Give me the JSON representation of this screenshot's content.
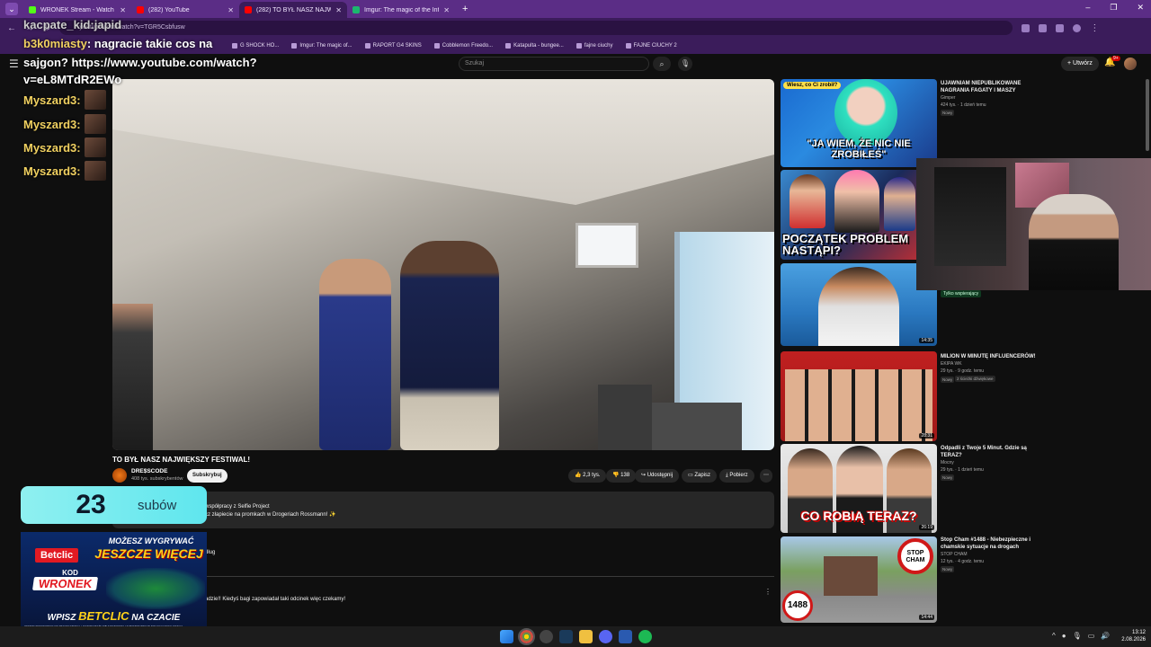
{
  "browser": {
    "tabs": [
      {
        "title": "WRONEK Stream - Watch Live",
        "color": "#53fc18"
      },
      {
        "title": "(282) YouTube",
        "color": "#ff0000"
      },
      {
        "title": "(282) TO BYŁ NASZ NAJWIĘKSZ",
        "color": "#ff0000",
        "active": true
      },
      {
        "title": "Imgur: The magic of the Interne",
        "color": "#1bb76e"
      }
    ],
    "new_tab": "+",
    "address": "youtube.com/watch?v=TGR5Csbfusw",
    "bookmarks": [
      "G SHOCK HO...",
      "Imgur: The magic of...",
      "RAPORT G4 SKINS",
      "Cobblemon Freedo...",
      "Katapulta - bungee...",
      "fajne ciuchy",
      "FAJNE CIUCHY 2"
    ]
  },
  "youtube": {
    "search_placeholder": "Szukaj",
    "create_label": "Utwórz",
    "notif_count": "9+"
  },
  "chat": {
    "line1": "kacpate_kid:japid",
    "line2_user": "b3k0miasty",
    "line2_msg": ": nagracie takie cos na",
    "line3": "sajgon? https://www.youtube.com/watch?v=eL8MTdR2EWo",
    "emote_lines": [
      "Myszard3:",
      "Myszard3:",
      "Myszard3:",
      "Myszard3:"
    ]
  },
  "video": {
    "title": "TO BYŁ NASZ NAJWIĘKSZY FESTIWAL!",
    "channel": "DRE$SCODE",
    "subscribers": "408 tys. subskrybentów",
    "subscribe_label": "Subskrybuj",
    "likes": "2,3 tys.",
    "dislikes": "138",
    "share": "Udostępnij",
    "save": "Zapisz",
    "download": "Pobierz",
    "desc1": "współpracy z Selfie Project",
    "desc2": "cz złapiecie na promkach w Drogeriach Rossmann! ✨",
    "comments_frag": "dług",
    "comment_frag": "adzie!! Kiedyś bagi zapowiadał taki odcinek więc czekamy!"
  },
  "sidebar": [
    {
      "title": "UJAWNIAM NIEPUBLIKOWANE NAGRANIA FAGATY I MASZY",
      "channel": "Gimper",
      "meta": "424 tys. · 1 dzień temu",
      "badge": "Nowy",
      "thumb_text": "\"JA WIEM, ŻE NIC NIE ZROBIŁEŚ\"",
      "bubble": "Wiesz, co Ci zrobił?"
    },
    {
      "title": "",
      "channel": "",
      "meta": "",
      "badge": "",
      "thumb_text": "POCZĄTEK PROBLEM NASTĄPI?",
      "bubble": ""
    },
    {
      "title": "",
      "channel": "",
      "meta": "",
      "badge": "",
      "duration": "14:35"
    },
    {
      "title": "MILION W MINUTĘ INFLUENCERÓW!",
      "channel": "EKIPA WK",
      "meta": "29 tys. · 9 godz. temu",
      "badge": "Nowy",
      "badge2": "2 ścieżki dźwiękowe",
      "duration": "28:31"
    },
    {
      "title": "Odpadli z Twoje 5 Minut. Gdzie są TERAZ?",
      "channel": "Mocny",
      "meta": "29 tys. · 1 dzień temu",
      "badge": "Nowy",
      "thumb_text": "CO ROBIĄ TERAZ?",
      "duration": "26:19"
    },
    {
      "title": "Stop Cham #1488 - Niebezpieczne i chamskie sytuacje na drogach",
      "channel": "STOP CHAM",
      "meta": "12 tys. · 4 godz. temu",
      "badge": "Nowy",
      "thumb_text": "1488",
      "sign": "STOP CHAM",
      "duration": "14:44"
    }
  ],
  "only_members": "Tylko wspierający",
  "sub_counter": {
    "value": "23",
    "label": "subów"
  },
  "ad": {
    "brand": "Betclic",
    "slogan1": "MOŻESZ WYGRYWAĆ",
    "slogan2": "JESZCZE WIĘCEJ",
    "code1": "KOD",
    "code2": "WRONEK",
    "cta_pre": "WPISZ",
    "cta_code": "BETCLIC",
    "cta_post": "NA CZACIE",
    "fine": "OFERTA SKIEROWANA DO PEŁNOLETNICH. HAZARD WIĄŻE SIĘ Z RYZYKIEM. UCZESTNICTWO W NIELEGALNYCH GRACH HAZARDOWYCH JEST ZAGROŻONE ODPOWIEDZIALNOŚCIĄ KARNO-SKARBOWĄ."
  },
  "taskbar": {
    "time": "13:12",
    "date": "2.08.2026"
  }
}
